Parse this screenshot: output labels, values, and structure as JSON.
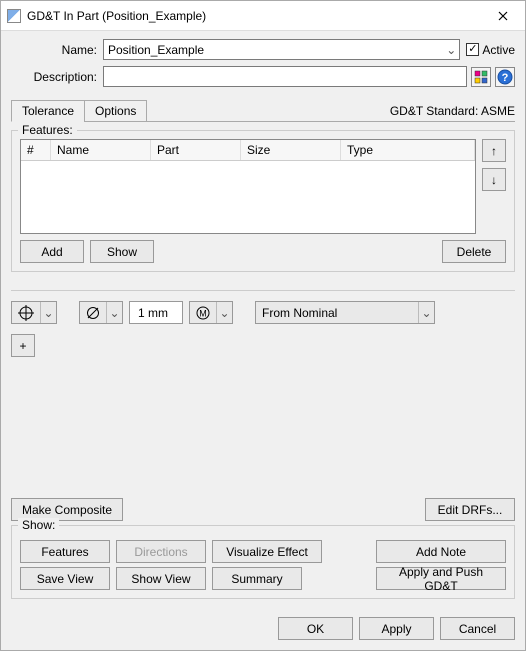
{
  "window": {
    "title": "GD&T In Part (Position_Example)"
  },
  "header": {
    "name_label": "Name:",
    "name_value": "Position_Example",
    "active_label": "Active",
    "active_checked": true,
    "description_label": "Description:",
    "description_value": ""
  },
  "tabs": {
    "tolerance": "Tolerance",
    "options": "Options",
    "standard_label": "GD&T Standard: ASME"
  },
  "features": {
    "fieldset_label": "Features:",
    "columns": {
      "num": "#",
      "name": "Name",
      "part": "Part",
      "size": "Size",
      "type": "Type"
    },
    "add": "Add",
    "show": "Show",
    "delete": "Delete",
    "up": "↑",
    "down": "↓"
  },
  "tolerance": {
    "value": "1 mm",
    "datum_source": "From Nominal",
    "plus": "+",
    "make_composite": "Make Composite",
    "edit_drfs": "Edit DRFs..."
  },
  "show": {
    "fieldset_label": "Show:",
    "features": "Features",
    "directions": "Directions",
    "visualize": "Visualize Effect",
    "add_note": "Add Note",
    "save_view": "Save View",
    "show_view": "Show View",
    "summary": "Summary",
    "apply_push": "Apply and Push GD&T"
  },
  "footer": {
    "ok": "OK",
    "apply": "Apply",
    "cancel": "Cancel"
  }
}
